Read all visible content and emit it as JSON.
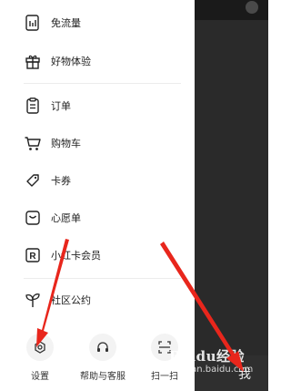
{
  "drawer": {
    "items": [
      {
        "label": "免流量",
        "icon": "traffic-card-icon"
      },
      {
        "label": "好物体验",
        "icon": "gift-icon"
      },
      {
        "label": "订单",
        "icon": "clipboard-icon"
      },
      {
        "label": "购物车",
        "icon": "cart-icon"
      },
      {
        "label": "卡券",
        "icon": "coupon-icon"
      },
      {
        "label": "心愿单",
        "icon": "wishlist-icon"
      },
      {
        "label": "小红卡会员",
        "icon": "membership-r-icon"
      },
      {
        "label": "社区公约",
        "icon": "sprout-icon"
      }
    ],
    "bottom": [
      {
        "label": "设置",
        "icon": "settings-icon"
      },
      {
        "label": "帮助与客服",
        "icon": "headset-icon"
      },
      {
        "label": "扫一扫",
        "icon": "scan-icon"
      }
    ]
  },
  "background_page": {
    "tab_label": "我"
  },
  "watermark": {
    "text": "Baidu经验",
    "subtext": "jingyan.baidu.com"
  },
  "colors": {
    "arrow": "#e8261c",
    "overlay": "#2a2a2a",
    "text": "#222222"
  }
}
